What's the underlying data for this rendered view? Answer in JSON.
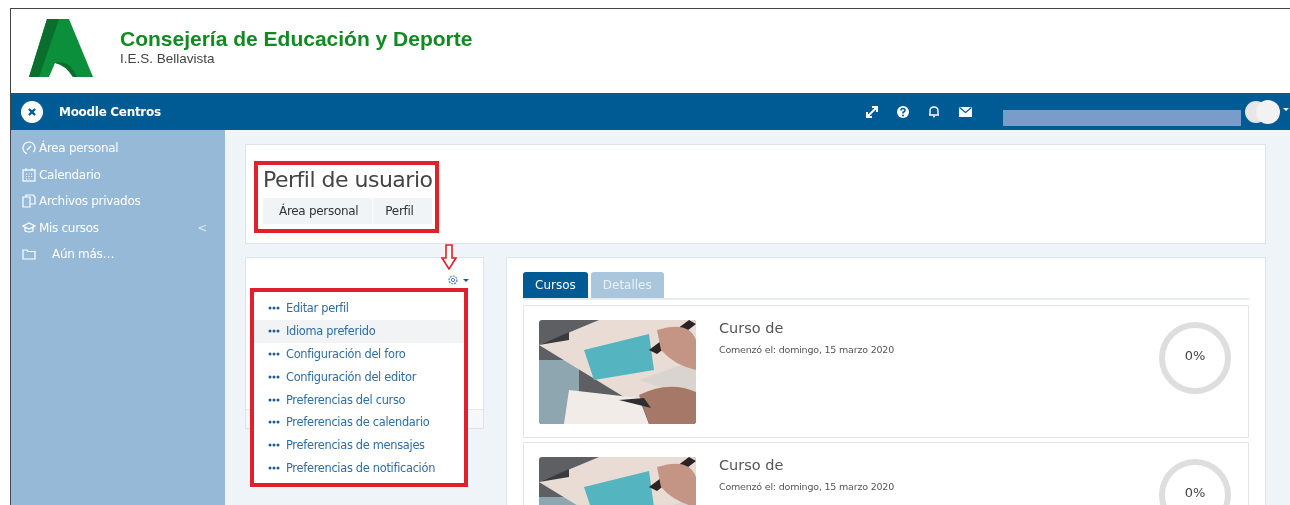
{
  "header": {
    "title": "Consejería de Educación y Deporte",
    "subtitle": "I.E.S. Bellavista"
  },
  "navbar": {
    "site_name": "Moodle Centros"
  },
  "sidebar": {
    "items": [
      {
        "label": "Área personal"
      },
      {
        "label": "Calendario"
      },
      {
        "label": "Archivos privados"
      },
      {
        "label": "Mis cursos",
        "chevron": "<"
      },
      {
        "label": "Aún más…"
      }
    ]
  },
  "page_header": {
    "title": "Perfil de usuario",
    "breadcrumb": [
      "Área personal",
      "Perfil"
    ]
  },
  "settings_menu": {
    "items": [
      {
        "label": "Editar perfil",
        "selected": false
      },
      {
        "label": "Idioma preferido",
        "selected": true
      },
      {
        "label": "Configuración del foro",
        "selected": false
      },
      {
        "label": "Configuración del editor",
        "selected": false
      },
      {
        "label": "Preferencias del curso",
        "selected": false
      },
      {
        "label": "Preferencias de calendario",
        "selected": false
      },
      {
        "label": "Preferencias de mensajes",
        "selected": false
      },
      {
        "label": "Preferencias de notificación",
        "selected": false
      }
    ]
  },
  "tabs": [
    {
      "label": "Cursos",
      "selected": true
    },
    {
      "label": "Detalles",
      "selected": false
    }
  ],
  "courses": [
    {
      "title": "Curso de",
      "started": "Comenzó el: domingo, 15 marzo 2020",
      "level": 0,
      "reading": "0%"
    },
    {
      "title": "Curso de",
      "started": "Comenzó el: domingo, 15 marzo 2020",
      "level": 0,
      "reading": "0%"
    }
  ]
}
